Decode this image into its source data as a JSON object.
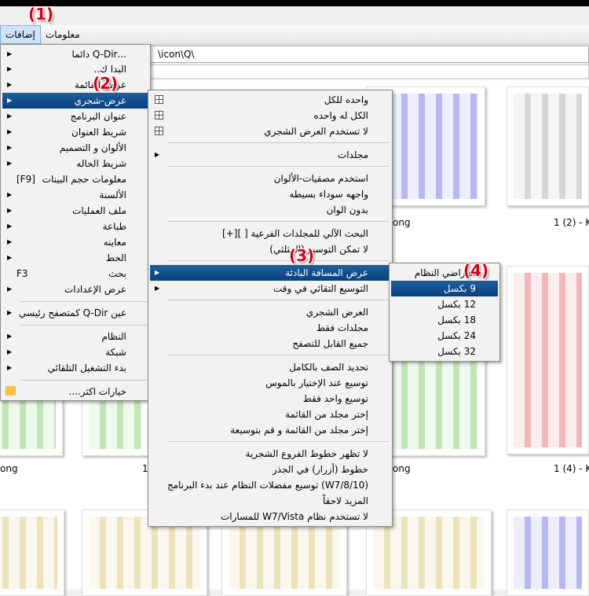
{
  "menubar": {
    "items": [
      {
        "label": "إضافات",
        "active": true
      },
      {
        "label": "معلومات",
        "active": false
      }
    ]
  },
  "address": {
    "value": "\\icon\\Q\\"
  },
  "annotations": [
    "(1)",
    "(2)",
    "(3)",
    "(4)"
  ],
  "captions": [
    "ong",
    "1 (2) - Ko",
    "ong",
    "1",
    "ong",
    "1 (4) - Ko"
  ],
  "colors": {
    "blue": "#b8b8f0",
    "gray": "#d6d6d6",
    "red": "#f0b8b8",
    "green": "#bfe6b4",
    "yellow": "#ece2bc",
    "accent": "#0b3f7c"
  },
  "main_menu": [
    {
      "label": "...Q-Dir دائما",
      "arrow": true
    },
    {
      "label": "البدا ك..",
      "arrow": true
    },
    {
      "label": "عرض-القائمة",
      "arrow": true
    },
    {
      "label": "عرض-شجري",
      "arrow": true,
      "highlight": true
    },
    {
      "label": "عنوان البرنامج",
      "arrow": true
    },
    {
      "label": "شريط العنوان",
      "arrow": true
    },
    {
      "label": "الألوان و التصميم",
      "arrow": true
    },
    {
      "label": "شريط الحاله",
      "arrow": true
    },
    {
      "label": "معلومات حجم البينات",
      "shortcut": "[F9]"
    },
    {
      "label": "الألسنة",
      "arrow": true
    },
    {
      "label": "ملف العمليات",
      "arrow": true
    },
    {
      "label": "طباعة",
      "arrow": true
    },
    {
      "label": "معاينه",
      "arrow": true
    },
    {
      "label": "الخط",
      "arrow": true
    },
    {
      "label": "بحث",
      "shortcut": "F3"
    },
    {
      "label": "عرض الإعدادات",
      "arrow": true
    },
    {
      "label": "عين Q-Dir كمتصفح رئيسي",
      "arrow": true
    },
    {
      "label": "النظام",
      "arrow": true
    },
    {
      "label": "شبكة",
      "arrow": true
    },
    {
      "label": "بدء التشغيل التلقائي",
      "arrow": true
    },
    {
      "label": "خيارات اكثر....",
      "icon": "folder-icon"
    }
  ],
  "tree_menu": [
    {
      "label": "واحده للكل",
      "icon": "tree-icon"
    },
    {
      "label": "الكل له واحده",
      "icon": "tree-icon"
    },
    {
      "label": "لا تستخدم العرض الشجري",
      "icon": "tree-icon"
    },
    {
      "label": "مجلدات",
      "arrow": true
    },
    {
      "label": "استخدم مصفيات-الألوان"
    },
    {
      "label": "واجهه سوداء بسيطه"
    },
    {
      "label": "بدون الوان"
    },
    {
      "label": "البحث الآلي للمجلدات الفرعية [ ][+]"
    },
    {
      "label": "لا تمكن التوسيع (المثلثي)"
    },
    {
      "label": "عرض المسافة البادئة",
      "arrow": true,
      "highlight": true
    },
    {
      "label": "التوسيع التقائي في وقت",
      "arrow": true
    },
    {
      "label": "العرض الشجري"
    },
    {
      "label": "مجلدات فقط"
    },
    {
      "label": "جميع القابل للتصفح"
    },
    {
      "label": "تحديد الصف بالكامل"
    },
    {
      "label": "توسيع عند الإختيار بالموس"
    },
    {
      "label": "توسيع واحد فقط"
    },
    {
      "label": "إختر مجلد من القائمة"
    },
    {
      "label": "إختر مجلد من القائمة و قم بتوسيعة"
    },
    {
      "label": "لا تظهر خطوط الفروع الشجرية"
    },
    {
      "label": "خطوط (أزرار) في الجذر"
    },
    {
      "label": "(W7/8/10) توسيع مفضلات النظام عند بدء البرنامج"
    },
    {
      "label": "المزيد لاحقاً"
    },
    {
      "label": "لا تستخدم نظام W7/Vista للمسارات"
    }
  ],
  "indent_menu": [
    {
      "label": "افتراضي النظام"
    },
    {
      "label": "9 بكسل",
      "highlight": true
    },
    {
      "label": "12 بكسل"
    },
    {
      "label": "18 بكسل"
    },
    {
      "label": "24 بكسل"
    },
    {
      "label": "32 بكسل"
    }
  ]
}
